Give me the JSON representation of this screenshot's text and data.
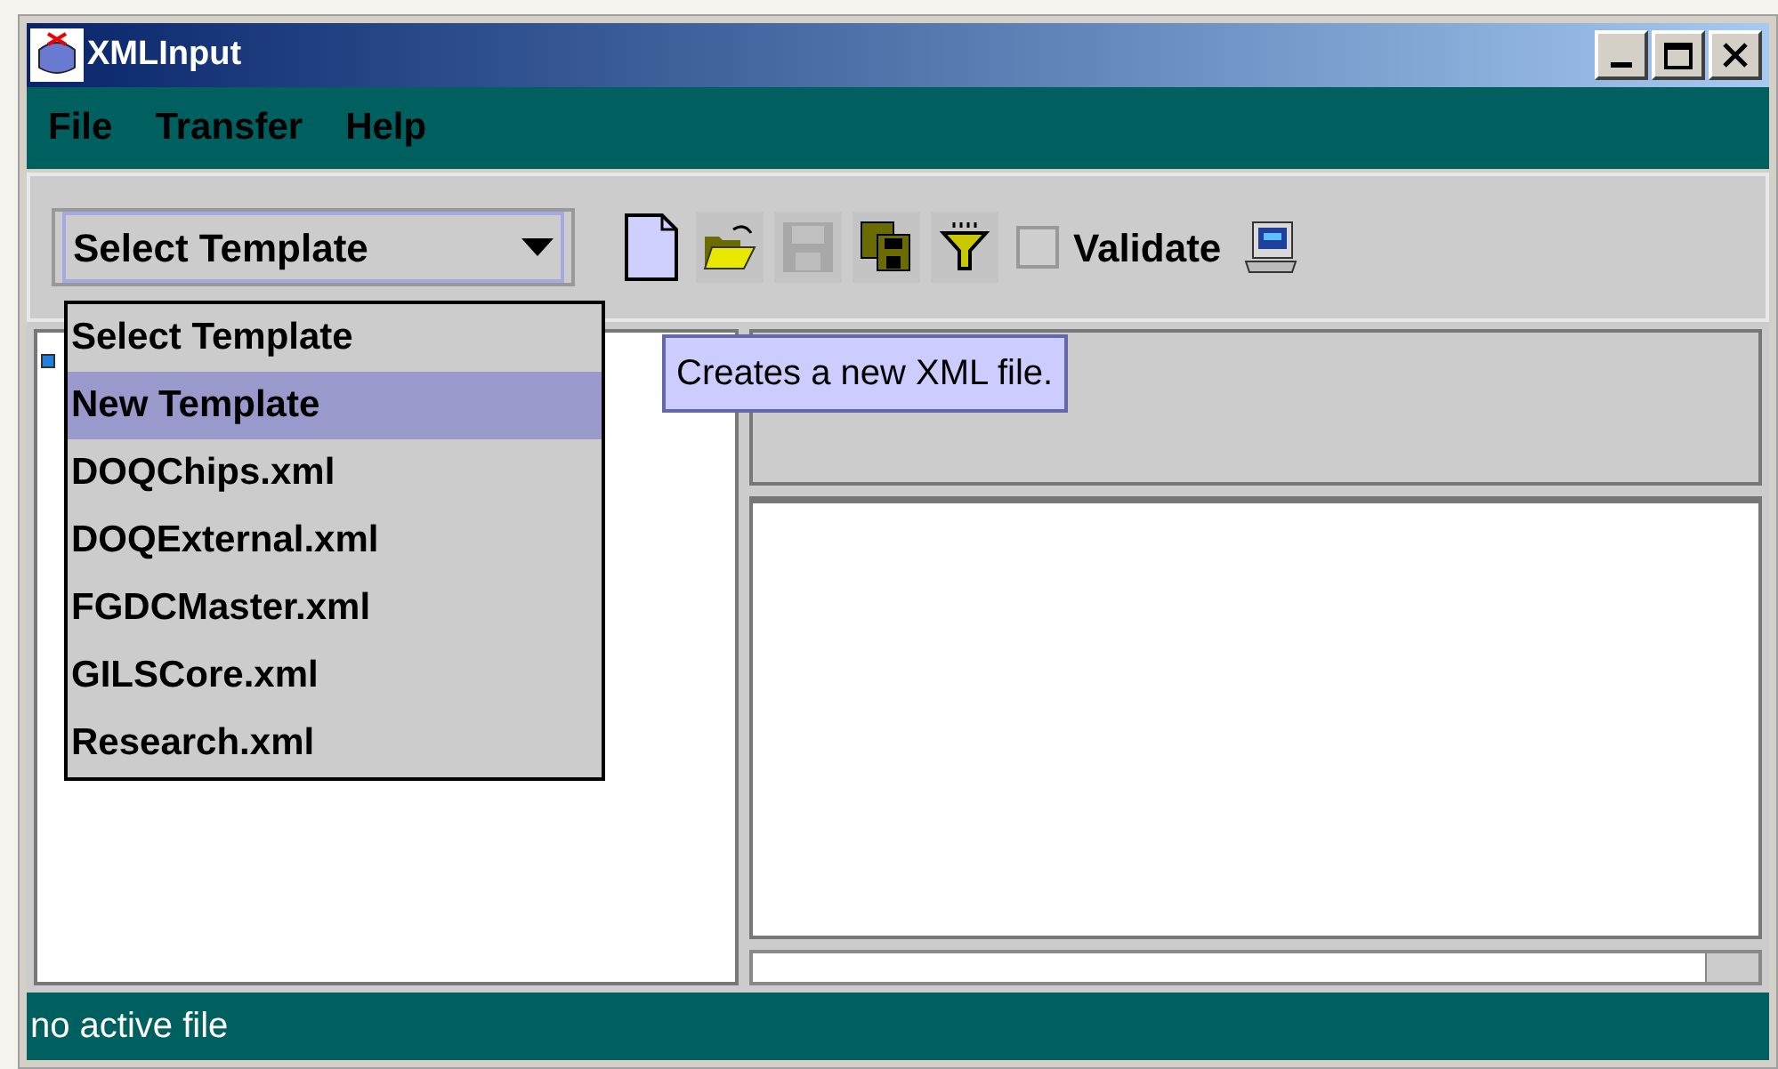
{
  "window": {
    "title": "XMLInput"
  },
  "menu": [
    "File",
    "Transfer",
    "Help"
  ],
  "template_select": {
    "value": "Select Template",
    "expanded": true,
    "options": [
      {
        "label": "Select Template",
        "highlighted": false
      },
      {
        "label": "New Template",
        "highlighted": true
      },
      {
        "label": "DOQChips.xml",
        "highlighted": false
      },
      {
        "label": "DOQExternal.xml",
        "highlighted": false
      },
      {
        "label": "FGDCMaster.xml",
        "highlighted": false
      },
      {
        "label": "GILSCore.xml",
        "highlighted": false
      },
      {
        "label": "Research.xml",
        "highlighted": false
      }
    ]
  },
  "tools": [
    {
      "kind": "new",
      "disabled": false
    },
    {
      "kind": "open",
      "disabled": false
    },
    {
      "kind": "save",
      "disabled": true
    },
    {
      "kind": "save-all",
      "disabled": false
    },
    {
      "kind": "filter",
      "disabled": false
    }
  ],
  "validate": {
    "label": "Validate",
    "checked": false
  },
  "tooltip": "Creates a new XML file.",
  "status_bar": "no active file"
}
